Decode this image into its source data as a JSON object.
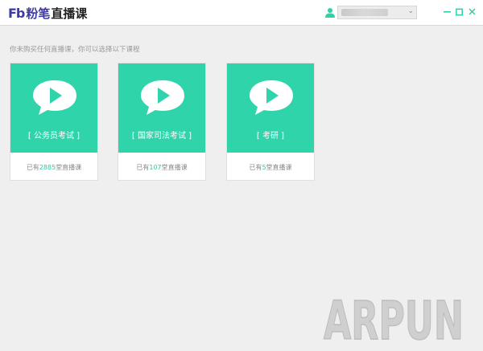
{
  "app": {
    "logo_mark": "Fb",
    "logo_brand": "粉笔",
    "title": "直播课"
  },
  "header": {
    "username_value": "",
    "window_controls": [
      "minimize",
      "maximize",
      "close"
    ]
  },
  "hint_text": "你未购买任何直播课，你可以选择以下课程",
  "courses": [
    {
      "name": "[ 公务员考试 ]",
      "count_prefix": "已有",
      "count": "2885",
      "count_suffix": "堂直播课"
    },
    {
      "name": "[ 国家司法考试 ]",
      "count_prefix": "已有",
      "count": "107",
      "count_suffix": "堂直播课"
    },
    {
      "name": "[ 考研 ]",
      "count_prefix": "已有",
      "count": "5",
      "count_suffix": "堂直播课"
    }
  ],
  "watermark": "ARPUN",
  "colors": {
    "accent": "#30d4ab",
    "brand": "#3d3aa6",
    "background": "#efefef"
  }
}
